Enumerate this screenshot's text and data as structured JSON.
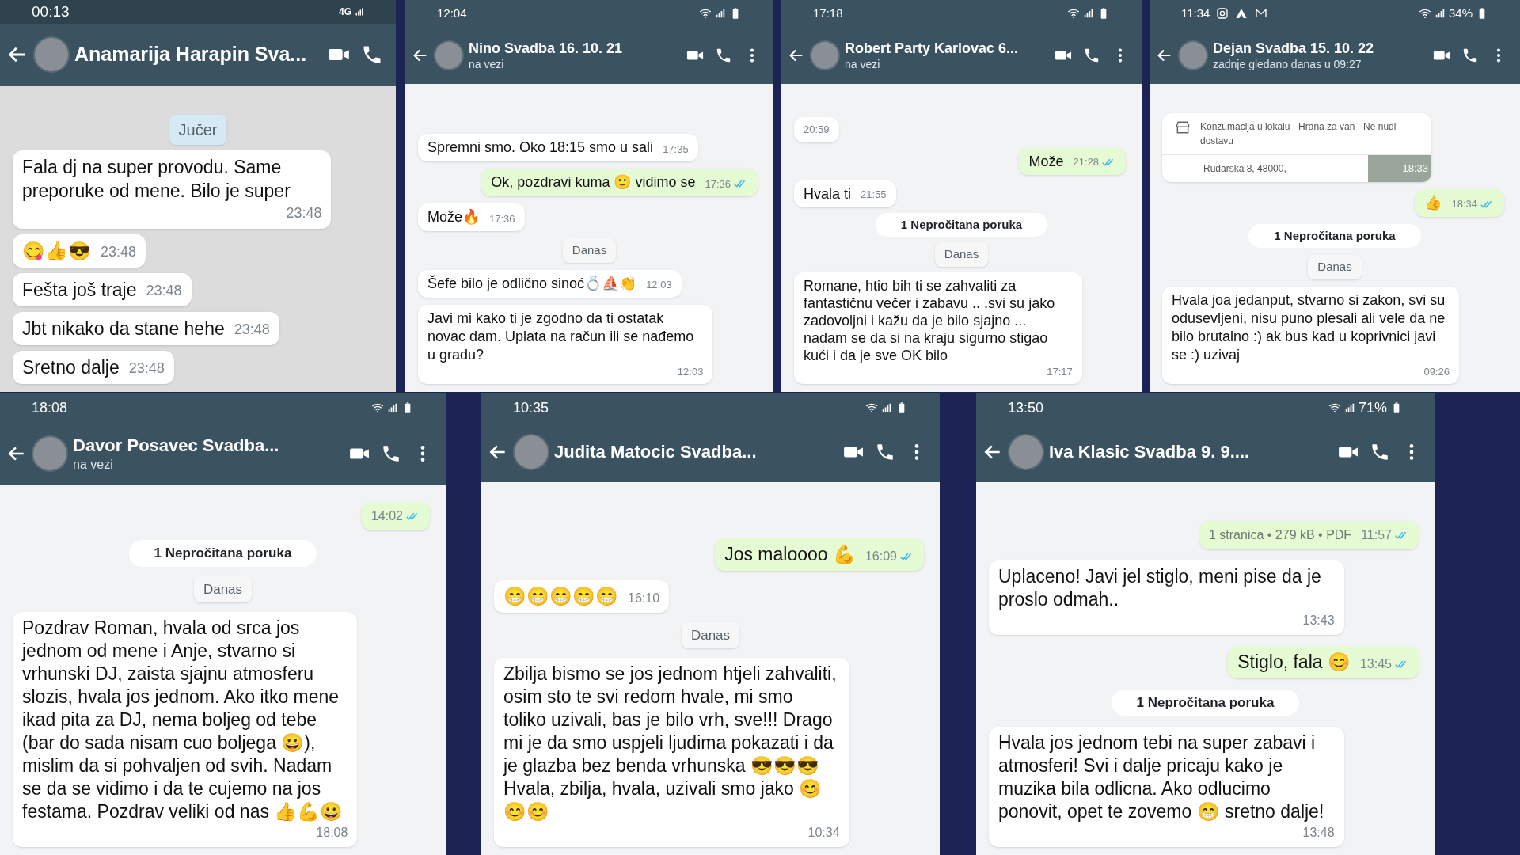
{
  "panels": [
    {
      "status_time": "00:13",
      "network_text": "4G",
      "title": "Anamarija Harapin Sva...",
      "has_menu": false,
      "messages": [
        {
          "kind": "date",
          "text": "Jučer"
        },
        {
          "kind": "in",
          "text": "Fala dj na super provodu. Same preporuke od mene. Bilo je super",
          "time": "23:48"
        },
        {
          "kind": "in",
          "text": "😋👍😎",
          "time": "23:48"
        },
        {
          "kind": "in",
          "text": "Fešta još traje",
          "time": "23:48"
        },
        {
          "kind": "in",
          "text": "Jbt nikako da stane hehe",
          "time": "23:48"
        },
        {
          "kind": "in",
          "text": "Sretno dalje",
          "time": "23:48"
        }
      ]
    },
    {
      "status_time": "12:04",
      "title": "Nino Svadba 16. 10. 21",
      "subtitle": "na vezi",
      "has_menu": true,
      "messages": [
        {
          "kind": "in",
          "text": "Spremni smo. Oko 18:15 smo u sali",
          "time": "17:35"
        },
        {
          "kind": "out",
          "text": "Ok, pozdravi kuma 🙂 vidimo se",
          "time": "17:36",
          "read": true
        },
        {
          "kind": "in",
          "text": "Može🔥",
          "time": "17:36"
        },
        {
          "kind": "date",
          "text": "Danas"
        },
        {
          "kind": "in",
          "text": "Šefe bilo je odlično sinoć💍⛵👏",
          "time": "12:03"
        },
        {
          "kind": "in",
          "text": "Javi mi kako ti je zgodno da ti ostatak novac dam. Uplata na račun ili se nađemo u gradu?",
          "time": "12:03"
        }
      ]
    },
    {
      "status_time": "17:18",
      "title": "Robert Party Karlovac 6...",
      "subtitle": "na vezi",
      "has_menu": true,
      "messages": [
        {
          "kind": "in",
          "time": "20:59"
        },
        {
          "kind": "out",
          "text": "Može",
          "time": "21:28",
          "read": true
        },
        {
          "kind": "in",
          "text": "Hvala ti",
          "time": "21:55"
        },
        {
          "kind": "unread",
          "text": "1 Nepročitana poruka"
        },
        {
          "kind": "date",
          "text": "Danas"
        },
        {
          "kind": "in",
          "text": "Romane, htio bih ti se zahvaliti za fantastičnu večer i zabavu .. .svi su jako zadovoljni i kažu da je bilo sjajno ... nadam se da si na kraju sigurno stigao kući i da je sve OK bilo",
          "time": "17:17"
        }
      ]
    },
    {
      "status_time": "11:34",
      "battery_text": "34%",
      "title": "Dejan Svadba 15. 10. 22",
      "subtitle": "zadnje gledano danas u 09:27",
      "has_menu": true,
      "messages": [
        {
          "kind": "card",
          "text": "Konzumacija u lokalu · Hrana za van · Ne nudi dostavu",
          "address": "Rudarska 8, 48000,",
          "time": "18:33"
        },
        {
          "kind": "out",
          "text": "👍",
          "time": "18:34",
          "read": true
        },
        {
          "kind": "unread",
          "text": "1 Nepročitana poruka"
        },
        {
          "kind": "date",
          "text": "Danas"
        },
        {
          "kind": "in",
          "text": "Hvala joa jedanput, stvarno si zakon, svi su odusevljeni, nisu puno plesali ali vele da ne bilo brutalno :) ak bus kad u koprivnici javi se :) uzivaj",
          "time": "09:26"
        }
      ]
    },
    {
      "status_time": "18:08",
      "title": "Davor Posavec Svadba...",
      "subtitle": "na vezi",
      "has_menu": true,
      "messages": [
        {
          "kind": "out",
          "time": "14:02",
          "read": true
        },
        {
          "kind": "unread",
          "text": "1 Nepročitana poruka"
        },
        {
          "kind": "date",
          "text": "Danas"
        },
        {
          "kind": "in",
          "text": "Pozdrav Roman, hvala od srca jos jednom od mene i Anje, stvarno si vrhunski DJ, zaista sjajnu atmosferu slozis, hvala jos jednom. Ako itko mene ikad pita za DJ, nema boljeg od tebe (bar do sada nisam cuo boljega 😀), mislim da si pohvaljen od svih. Nadam se da se vidimo i da te cujemo na jos festama. Pozdrav veliki od nas 👍💪😀",
          "time": "18:08"
        }
      ]
    },
    {
      "status_time": "10:35",
      "title": "Judita Matocic Svadba...",
      "has_menu": true,
      "messages": [
        {
          "kind": "out",
          "text": "Jos maloooo 💪",
          "time": "16:09",
          "read": true
        },
        {
          "kind": "in",
          "text": "😁😁😁😁😁",
          "time": "16:10"
        },
        {
          "kind": "date",
          "text": "Danas"
        },
        {
          "kind": "in",
          "text": "Zbilja bismo se jos jednom htjeli zahvaliti, osim sto te svi redom hvale, mi smo toliko uzivali, bas je bilo vrh, sve!!! Drago mi je da smo uspjeli ljudima pokazati i da je glazba bez benda vrhunska 😎😎😎 Hvala, zbilja, hvala, uzivali smo jako 😊 😊😊",
          "time": "10:34"
        }
      ]
    },
    {
      "status_time": "13:50",
      "battery_text": "71%",
      "title": "Iva Klasic Svadba 9. 9....",
      "has_menu": true,
      "messages": [
        {
          "kind": "doc",
          "text": "1 stranica • 279 kB • PDF",
          "time": "11:57",
          "read": true
        },
        {
          "kind": "in",
          "text": "Uplaceno! Javi jel stiglo, meni pise da je proslo odmah..",
          "time": "13:43"
        },
        {
          "kind": "out",
          "text": "Stiglo, fala 😊",
          "time": "13:45",
          "read": true
        },
        {
          "kind": "unread",
          "text": "1 Nepročitana poruka"
        },
        {
          "kind": "in",
          "text": "Hvala jos jednom tebi na super zabavi i atmosferi! Svi i dalje pricaju kako je muzika bila odlicna. Ako odlucimo ponovit, opet te zovemo 😁 sretno dalje!",
          "time": "13:48"
        }
      ]
    }
  ]
}
